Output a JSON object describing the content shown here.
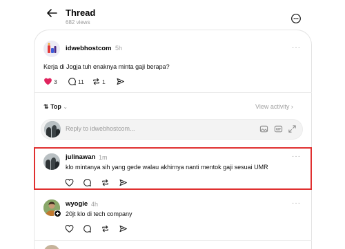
{
  "header": {
    "title": "Thread",
    "views": "682 views"
  },
  "original_post": {
    "username": "idwebhostcom",
    "time": "5h",
    "text": "Kerja di Jogja tuh enaknya minta gaji berapa?",
    "likes": "3",
    "comments": "11",
    "reposts": "1",
    "more": "···"
  },
  "sort": {
    "label": "Top",
    "chevron": "⌄",
    "view_activity": "View activity ›"
  },
  "reply": {
    "placeholder": "Reply to idwebhostcom..."
  },
  "replies": [
    {
      "username": "julinawan",
      "time": "1m",
      "text": "klo mintanya sih yang gede walau akhirnya nanti mentok gaji sesuai UMR",
      "more": "···"
    },
    {
      "username": "wyogie",
      "time": "4h",
      "text": "20jt klo di tech company",
      "more": "···"
    }
  ],
  "colors": {
    "accent_heart": "#e0245e",
    "highlight": "#e03030",
    "muted": "#999999"
  }
}
